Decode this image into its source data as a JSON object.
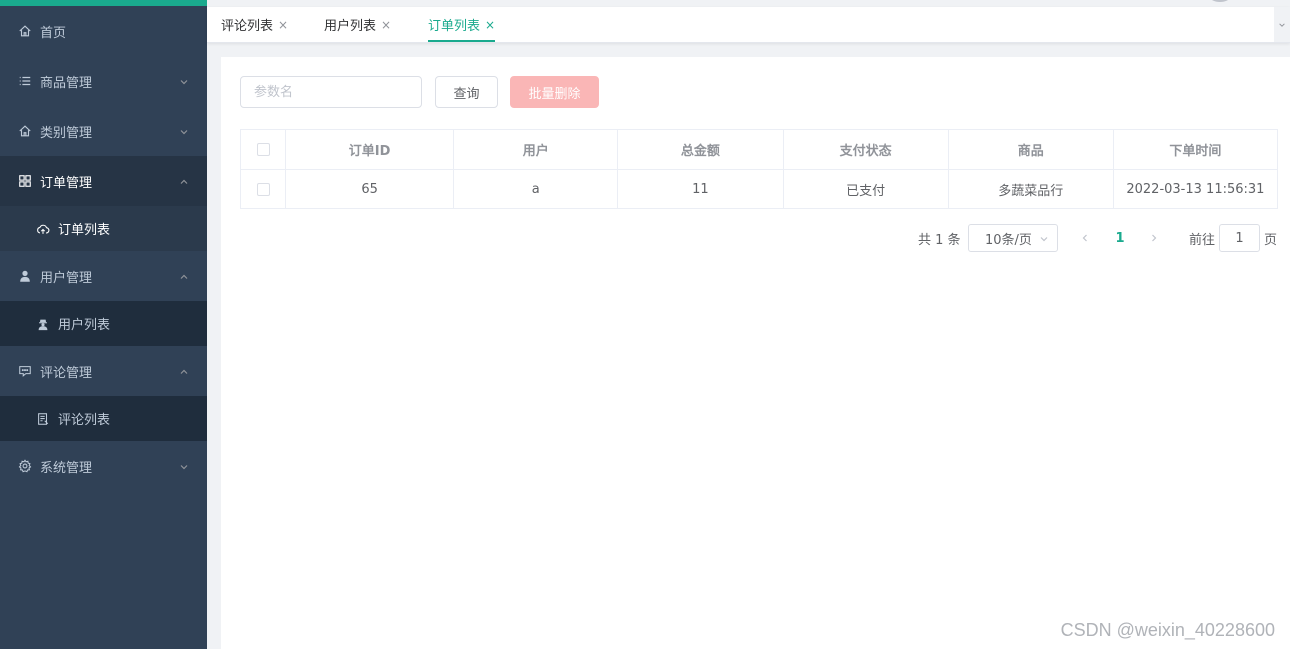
{
  "sidebar": {
    "items": [
      {
        "label": "首页",
        "icon": "home-icon"
      },
      {
        "label": "商品管理",
        "icon": "list-icon"
      },
      {
        "label": "类别管理",
        "icon": "home-icon"
      },
      {
        "label": "订单管理",
        "icon": "grid-icon",
        "expanded": true,
        "children": [
          {
            "label": "订单列表",
            "icon": "upload-cloud-icon",
            "active": true
          }
        ]
      },
      {
        "label": "用户管理",
        "icon": "user-icon",
        "expanded": true,
        "children": [
          {
            "label": "用户列表",
            "icon": "user-secret-icon"
          }
        ]
      },
      {
        "label": "评论管理",
        "icon": "comment-icon",
        "expanded": true,
        "children": [
          {
            "label": "评论列表",
            "icon": "document-icon"
          }
        ]
      },
      {
        "label": "系统管理",
        "icon": "gear-icon"
      }
    ]
  },
  "tabs": [
    {
      "label": "评论列表",
      "close": "×"
    },
    {
      "label": "用户列表",
      "close": "×"
    },
    {
      "label": "订单列表",
      "close": "×",
      "active": true
    }
  ],
  "toolbar": {
    "search_placeholder": "参数名",
    "query_label": "查询",
    "batch_delete_label": "批量删除"
  },
  "table": {
    "columns": [
      "订单ID",
      "用户",
      "总金额",
      "支付状态",
      "商品",
      "下单时间"
    ],
    "rows": [
      [
        "65",
        "a",
        "11",
        "已支付",
        "多蔬菜品行",
        "2022-03-13 11:56:31"
      ]
    ]
  },
  "pagination": {
    "total_text": "共 1 条",
    "page_size": "10条/页",
    "current_page": "1",
    "goto_prefix": "前往",
    "goto_value": "1",
    "goto_suffix": "页"
  },
  "watermark": "CSDN @weixin_40228600",
  "colors": {
    "accent": "#1aaa8e",
    "sidebar_bg": "#304156",
    "danger_disabled": "#fab6b6"
  }
}
